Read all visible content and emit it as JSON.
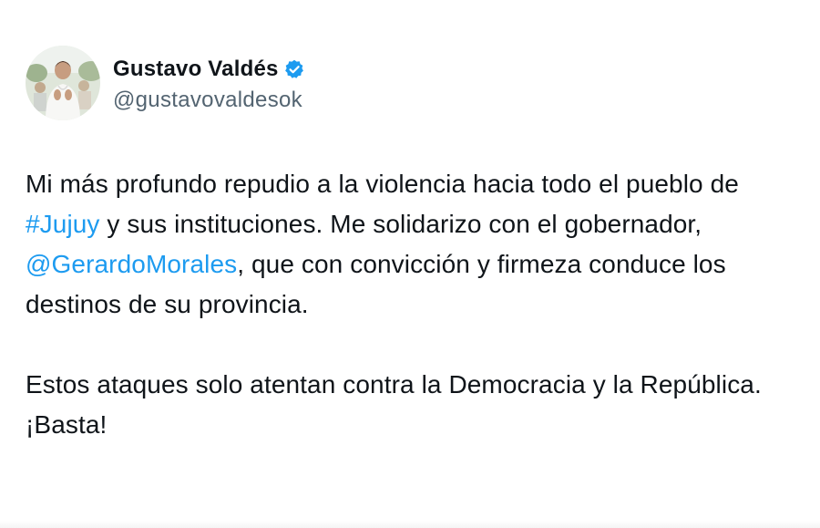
{
  "author": {
    "display_name": "Gustavo Valdés",
    "handle": "@gustavovaldesok",
    "verified": true,
    "verified_color": "#1d9bf0"
  },
  "tweet": {
    "p1_seg1": "Mi más profundo repudio a la violencia hacia todo el pueblo de ",
    "hashtag": "#Jujuy",
    "p1_seg2": " y sus instituciones. Me solidarizo con el gobernador, ",
    "mention": "@GerardoMorales",
    "p1_seg3": ", que con convicción y firmeza conduce los destinos de su provincia.",
    "p2": "Estos ataques solo atentan contra la Democracia y la República. ¡Basta!"
  },
  "colors": {
    "link": "#1d9bf0",
    "text": "#0f1419",
    "secondary": "#536471"
  }
}
